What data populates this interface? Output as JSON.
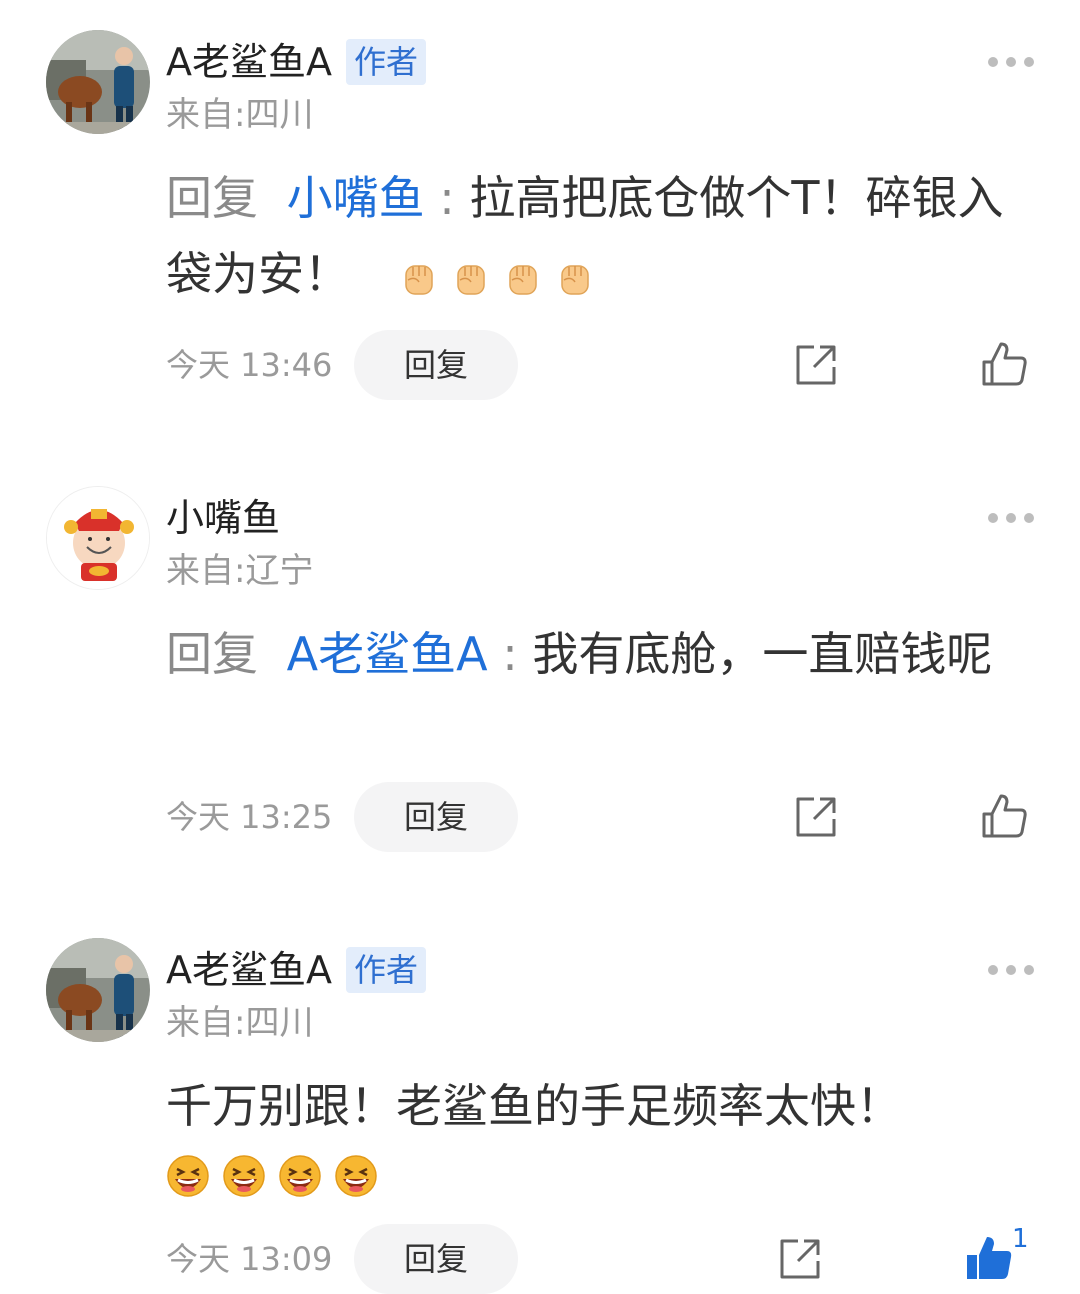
{
  "comments": [
    {
      "author": "A老鲨鱼A",
      "author_badge": "作者",
      "location": "来自:四川",
      "reply_prefix": "回复",
      "reply_to": "小嘴鱼",
      "separator": ":",
      "text": "拉高把底仓做个T！碎银入袋为安！",
      "emojis": [
        "fist-emoji",
        "fist-emoji",
        "fist-emoji",
        "fist-emoji"
      ],
      "time": "今天 13:46",
      "reply_label": "回复"
    },
    {
      "author": "小嘴鱼",
      "location": "来自:辽宁",
      "reply_prefix": "回复",
      "reply_to": "A老鲨鱼A",
      "separator": ":",
      "text": "我有底舱，一直赔钱呢",
      "time": "今天 13:25",
      "reply_label": "回复"
    },
    {
      "author": "A老鲨鱼A",
      "author_badge": "作者",
      "location": "来自:四川",
      "text": "千万别跟！老鲨鱼的手足频率太快！",
      "emojis": [
        "laughing-emoji",
        "laughing-emoji",
        "laughing-emoji",
        "laughing-emoji"
      ],
      "time": "今天 13:09",
      "reply_label": "回复",
      "like_count": "1",
      "liked": true
    }
  ],
  "colors": {
    "mention": "#1f6fd8",
    "like_active": "#1f6fd8",
    "badge_bg": "#e3edfb",
    "muted": "#9a9a9a"
  }
}
